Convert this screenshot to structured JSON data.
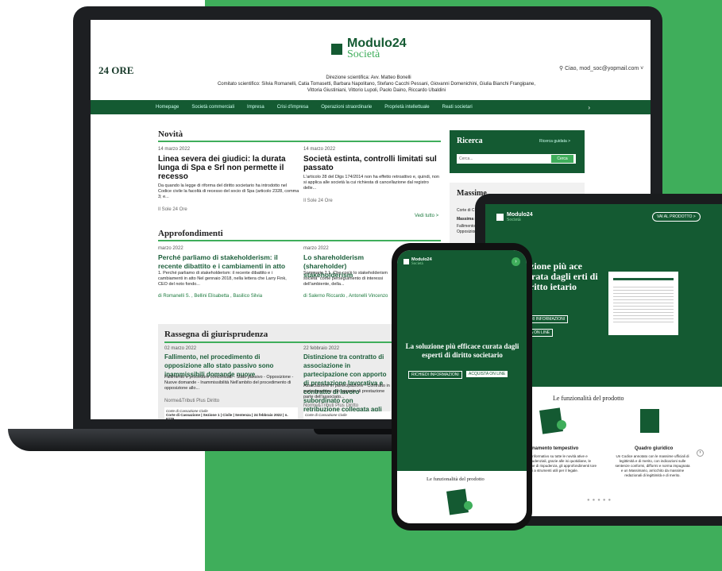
{
  "header": {
    "logo24": "24 ORE",
    "brand1": "Modulo24",
    "brand2": "Società",
    "user": "Ciao, mod_soc@yopmail.com",
    "direzione": "Direzione scientifica: Avv. Matteo Bonelli",
    "comitato": "Comitato scientifico: Silvia Romanelli, Catia Tomasetti, Barbara Napolitano, Stefano Cacchi Pessani, Giovanni Domenichini, Giulia Bianchi Frangipane, Vittoria Giustiniani, Vittorio Lupoli, Paolo Daino, Riccardo Ubaldini"
  },
  "nav": [
    "Homepage",
    "Società commerciali",
    "Impresa",
    "Crisi d'impresa",
    "Operazioni straordinarie",
    "Proprietà intellettuale",
    "Reati societari"
  ],
  "novita": {
    "title": "Novità",
    "vedi": "Vedi tutto >",
    "a1": {
      "date": "14 marzo 2022",
      "title": "Linea severa dei giudici: la durata lunga di Spa e Srl non permette il recesso",
      "abs": "Da quando la legge di riforma del diritto societario ha introdotto nel Codice civile la facoltà di recesso del socio di Spa (articolo 2328, comma 3; e...",
      "src": "Il Sole 24 Ore"
    },
    "a2": {
      "date": "14 marzo 2022",
      "title": "Società estinta, controlli limitati sul passato",
      "abs": "L'articolo 28 del Dlgs 174/2014 non ha effetto retroattivo e, quindi, non si applica alle società la cui richiesta di cancellazione dal registro delle...",
      "src": "Il Sole 24 Ore"
    }
  },
  "approf": {
    "title": "Approfondimenti",
    "a1": {
      "date": "marzo 2022",
      "title": "Perché parliamo di stakeholderism: il recente dibattito e i cambiamenti in atto",
      "abs": "1. Perché parliamo di stakeholderism: il recente dibattito e i cambiamenti in atto Nel gennaio 2018, nella lettera che Larry Fink, CEO del noto fondo...",
      "auth": "di Romanelli S. , Bellini Elisabetta , Basilico Silvia"
    },
    "a2": {
      "date": "marzo 2022",
      "title": "Lo shareholderism (shareholder) stakeholderism",
      "abs": "Sommario 2.1. Che cos'è lo stakeholderism società\" come perseguimento di interessi dell'ambiente, della...",
      "auth": "di Salerno Riccardo , Antonelli Vincenzo"
    }
  },
  "ricerca": {
    "title": "Ricerca",
    "guidata": "Ricerca guidata >",
    "placeholder": "Cerca...",
    "btn": "Cerca"
  },
  "massime": {
    "title": "Massime",
    "l1": "Corte di C",
    "l2": "Massima n",
    "l3": "Fallimento",
    "l4": "Opposizion"
  },
  "rassegna": {
    "title": "Rassegna di giurisprudenza",
    "a1": {
      "date": "02 marzo 2022",
      "title": "Fallimento, nel procedimento di opposizione allo stato passivo sono inammissibili domande nuove",
      "abs": "Fallimento e procedure concorsuali - Stato passivo - Opposizione - Nuove domande - Inammissibilità Nell'ambito del procedimento di opposizione allo...",
      "src": "Norme&Tributi Plus Diritto",
      "c1": "Corte di Cassazione Civile",
      "c2": "Corte di Cassazione | Sezione 1 | Civile | Sentenza | 24 febbraio 2022 | n. 6279"
    },
    "a2": {
      "date": "22 febbraio 2022",
      "title": "Distinzione tra contratto di associazione in partecipazione con apporto di prestazione lavorativa e contratto di lavoro subordinato con retribuzione collegata agli utili",
      "abs": "Associazione in partecipazione - Contratto in partecipazione con apporto di prestazione parte dell'associato...",
      "src": "Norme&Tributi Plus Diritto",
      "c1": "Corte di Cassazione Civile"
    }
  },
  "tablet": {
    "brand1": "Modulo24",
    "brand2": "Società",
    "cta": "VAI AL PRODOTTO >",
    "hero": "luzione più ace curata dagli erti di diritto ietario",
    "b1": "ERI INFORMAZIONI",
    "b2": "TA ON LINE",
    "feat": "Le funzionalità del prodotto",
    "f1t": "ggiornamento tempestivo",
    "f1d": "ervizio informativo su tutte le novità ative e giurisprudenziali, grazie alle isi quotidiane, le rassegne di rispudenza, gli approfondimenti tore integrati a strumenti utili per il legale.",
    "f2t": "Quadro giuridico",
    "f2d": "Un Codice annotato con le massime ufficiali di legittimità e di merito, con indicazioni sulle sentenze conformi, difformi e norma impugnata e un Massimario, arricchito da massime redazionali di legittimità e di merito."
  },
  "phone": {
    "brand1": "Modulo24",
    "brand2": "Società",
    "hero": "La soluzione più efficace curata dagli esperti di diritto societario",
    "b1": "RICHIEDI INFORMAZIONI",
    "b2": "ACQUISTA ON LINE",
    "feat": "Le funzionalità del prodotto"
  },
  "colors": {
    "dark_green": "#145a32",
    "accent_green": "#3fae5b"
  }
}
